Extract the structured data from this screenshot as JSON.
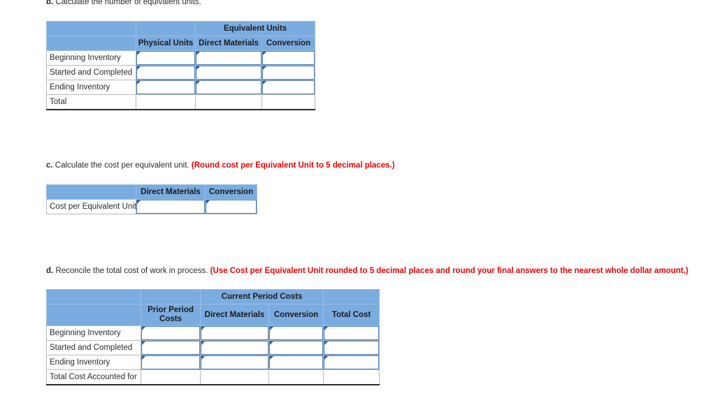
{
  "page": {
    "background": "#ffffff",
    "header_blue": "#7bace0",
    "input_border_blue": "#4a7ebb",
    "note_red": "#ee0000"
  },
  "sections": {
    "b": {
      "letter": "b.",
      "text": "Calculate the number of equivalent units.",
      "note": ""
    },
    "c": {
      "letter": "c.",
      "text": "Calculate the cost per equivalent unit.",
      "note": "(Round cost per Equivalent Unit to 5 decimal places.)"
    },
    "d": {
      "letter": "d.",
      "text": "Reconcile the total cost of work in process.",
      "note": "(Use Cost per Equivalent Unit rounded to 5 decimal places and round your final answers to the nearest whole dollar amount.)"
    }
  },
  "table_b": {
    "group_header": "Equivalent Units",
    "columns": [
      "",
      "Physical Units",
      "Direct Materials",
      "Conversion"
    ],
    "rows": [
      {
        "label": "Beginning Inventory",
        "inputs": [
          "",
          "",
          ""
        ],
        "editable": true
      },
      {
        "label": "Started and Completed",
        "inputs": [
          "",
          "",
          ""
        ],
        "editable": true
      },
      {
        "label": "Ending Inventory",
        "inputs": [
          "",
          "",
          ""
        ],
        "editable": true
      },
      {
        "label": "Total",
        "inputs": [
          "",
          "",
          ""
        ],
        "editable": false
      }
    ]
  },
  "table_c": {
    "columns": [
      "",
      "Direct Materials",
      "Conversion"
    ],
    "rows": [
      {
        "label": "Cost per Equivalent Unit",
        "inputs": [
          "",
          ""
        ],
        "editable": true
      }
    ]
  },
  "table_d": {
    "group_header": "Current Period Costs",
    "columns": [
      "",
      "Prior Period Costs",
      "Direct Materials",
      "Conversion",
      "Total Cost"
    ],
    "rows": [
      {
        "label": "Beginning Inventory",
        "inputs": [
          "",
          "",
          "",
          ""
        ],
        "editable": true
      },
      {
        "label": "Started and Completed",
        "inputs": [
          "",
          "",
          "",
          ""
        ],
        "editable": true
      },
      {
        "label": "Ending Inventory",
        "inputs": [
          "",
          "",
          "",
          ""
        ],
        "editable": true
      },
      {
        "label": "Total Cost Accounted for",
        "inputs": [
          "",
          "",
          "",
          ""
        ],
        "editable": false
      }
    ]
  }
}
